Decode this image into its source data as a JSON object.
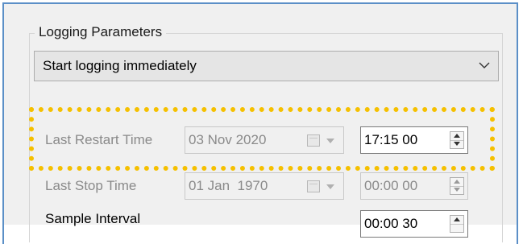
{
  "logging_parameters": {
    "group_title": "Logging Parameters",
    "mode": {
      "selected": "Start logging immediately"
    },
    "last_restart": {
      "label": "Last Restart Time",
      "date": "03 Nov 2020",
      "time": "17:15 00"
    },
    "last_stop": {
      "label": "Last Stop Time",
      "date": "01 Jan  1970",
      "time": "00:00 00"
    },
    "sample_interval": {
      "label": "Sample Interval",
      "time": "00:00 30"
    }
  },
  "colors": {
    "highlight": "#f5c000",
    "window_border": "#5b8fc7",
    "panel_bg": "#f0f0f0",
    "disabled_text": "#8a8a8a"
  },
  "icons": [
    "chevron-down-icon",
    "calendar-icon",
    "spin-up-icon",
    "spin-down-icon"
  ]
}
